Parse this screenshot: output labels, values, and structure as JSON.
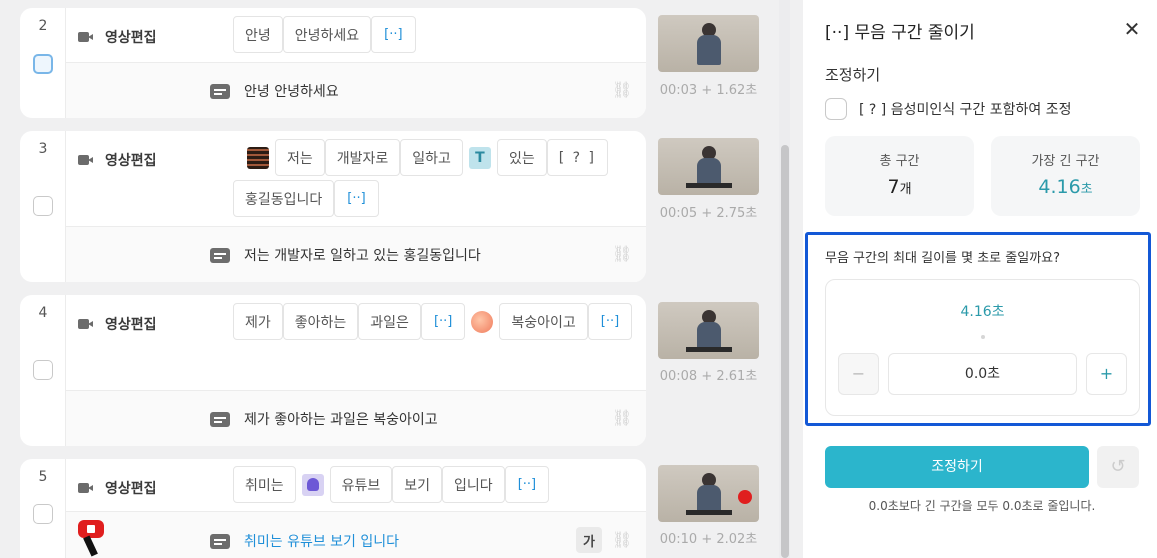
{
  "rows": [
    {
      "number": "2",
      "type_label": "영상편집",
      "tokens": [
        "안녕",
        "안녕하세요",
        "[··]"
      ],
      "subtitle": "안녕 안녕하세요",
      "timecode": "00:03 + 1.62초"
    },
    {
      "number": "3",
      "type_label": "영상편집",
      "tokens": [
        "저는",
        "개발자로",
        "일하고",
        "T",
        "있는",
        "[ ? ]",
        "홍길동입니다",
        "[··]"
      ],
      "subtitle": "저는 개발자로 일하고 있는 홍길동입니다",
      "timecode": "00:05 + 2.75초"
    },
    {
      "number": "4",
      "type_label": "영상편집",
      "tokens": [
        "제가",
        "좋아하는",
        "과일은",
        "[··]",
        "복숭아이고",
        "[··]"
      ],
      "subtitle": "제가 좋아하는 과일은 복숭아이고",
      "timecode": "00:08 + 2.61초"
    },
    {
      "number": "5",
      "type_label": "영상편집",
      "tokens": [
        "취미는",
        "유튜브",
        "보기",
        "입니다",
        "[··]"
      ],
      "subtitle": "취미는 유튜브 보기 입니다",
      "ga_label": "가",
      "timecode": "00:10 + 2.02초"
    }
  ],
  "panel": {
    "title": "[··] 무음 구간 줄이기",
    "close_icon": "close-icon",
    "section_label": "조정하기",
    "include_label": "[ ? ] 음성미인식 구간 포함하여 조정",
    "stats": [
      {
        "label": "총 구간",
        "value": "7",
        "unit": "개"
      },
      {
        "label": "가장 긴 구간",
        "value": "4.16",
        "unit": "초"
      }
    ],
    "question": "무음 구간의 최대 길이를 몇 초로 줄일까요?",
    "slider_value": "4.16초",
    "stepper_minus": "−",
    "stepper_value": "0.0초",
    "stepper_plus": "+",
    "apply_label": "조정하기",
    "note": "0.0초보다 긴 구간을 모두 0.0초로 줄입니다.",
    "accent_color": "#2bb5cc"
  }
}
